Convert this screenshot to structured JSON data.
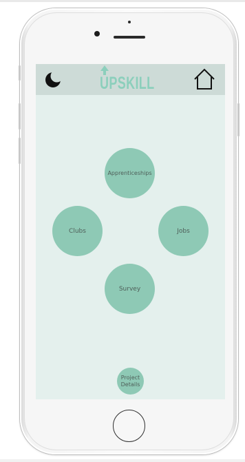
{
  "app": {
    "logo_text": "UPSKILL"
  },
  "header": {
    "theme_toggle_icon": "moon-icon",
    "home_icon": "house-outline-icon"
  },
  "menu": {
    "apprenticeships": "Apprenticeships",
    "clubs": "Clubs",
    "jobs": "Jobs",
    "survey": "Survey",
    "project_details_line1": "Project",
    "project_details_line2": "Details"
  },
  "colors": {
    "screen_background": "#e4f0ed",
    "header_background": "#cddbd7",
    "circle_fill": "#8ec9b5",
    "logo": "#8ccfbc"
  }
}
